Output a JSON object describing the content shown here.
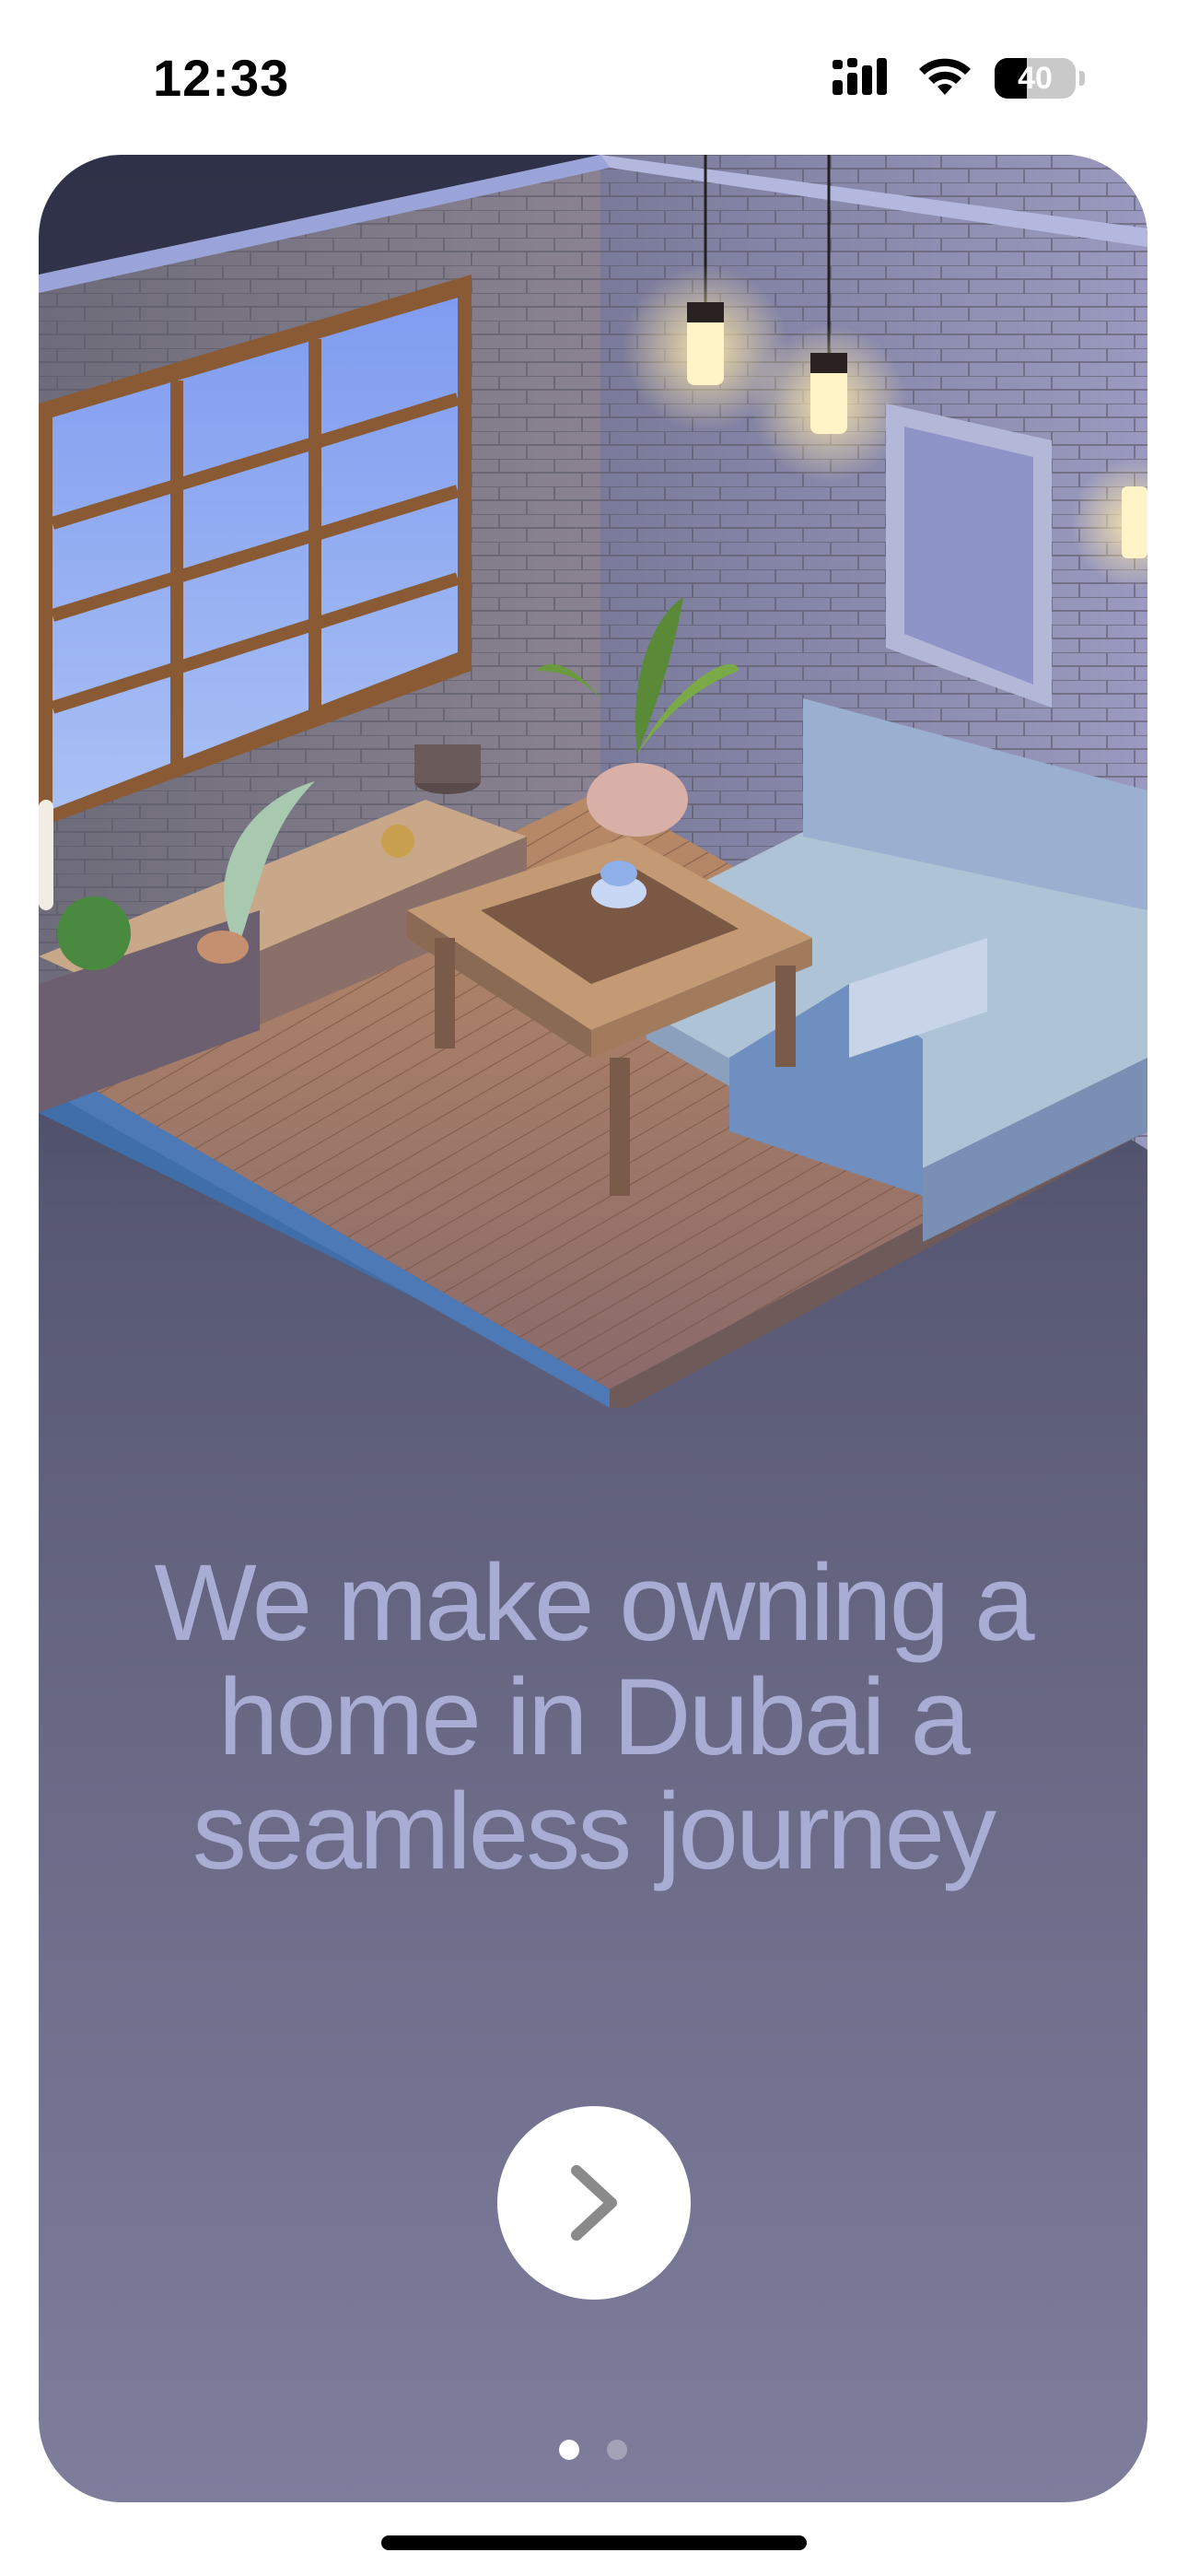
{
  "status_bar": {
    "time": "12:33",
    "battery_level": "40",
    "battery_fraction": 0.4,
    "icons": [
      "signal-icon",
      "wifi-icon",
      "battery-icon"
    ]
  },
  "onboarding": {
    "illustration": "isometric-living-room-illustration",
    "headline_lines": [
      "We make owning a",
      "home in Dubai a",
      "seamless journey"
    ],
    "next_button_icon": "chevron-right-icon",
    "page_count": 2,
    "active_page": 1
  },
  "colors": {
    "headline": "#a9acd3",
    "card_top": "#2f3148",
    "card_bottom": "#7e7d9c",
    "button": "#ffffff",
    "chevron": "#8a8a8a"
  }
}
